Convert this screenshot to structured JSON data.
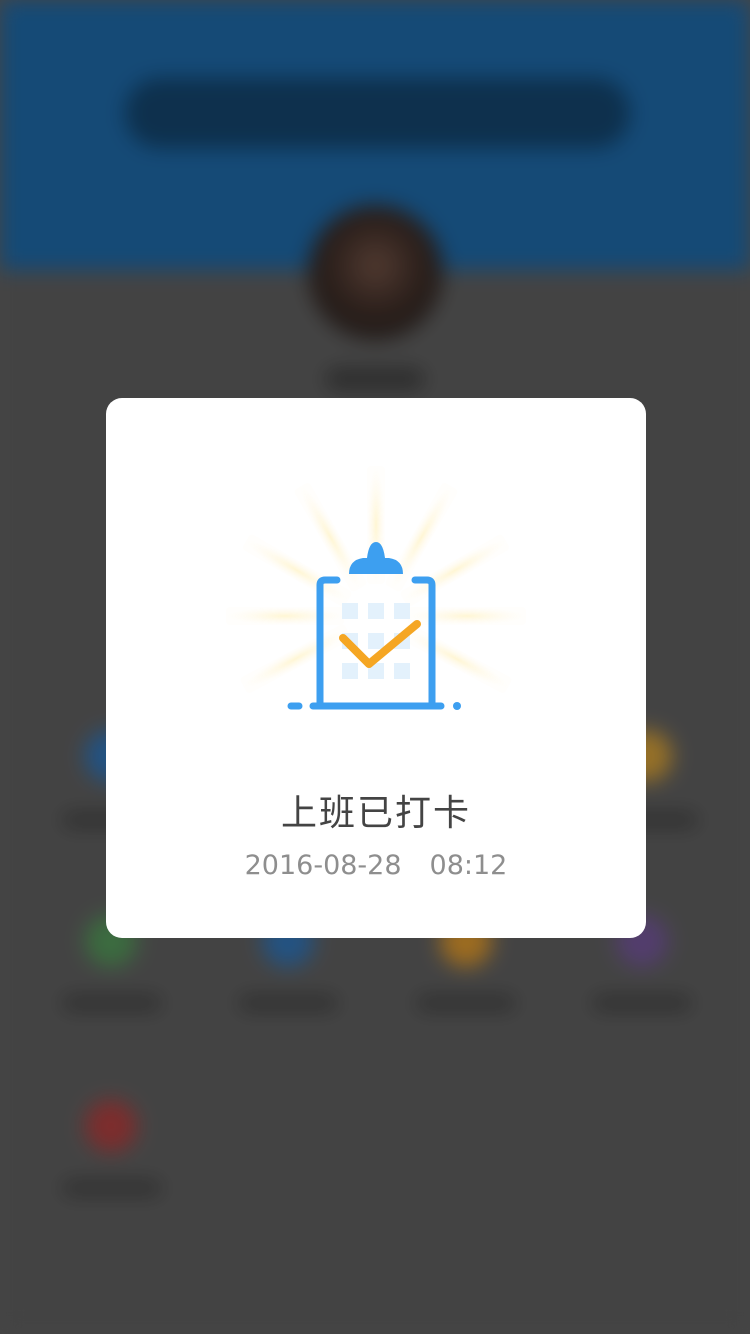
{
  "dialog": {
    "title": "上班已打卡",
    "date": "2016-08-28",
    "time": "08:12",
    "icon": "clipboard-check-icon"
  },
  "colors": {
    "header_blue": "#1b5f98",
    "dialog_bg": "#ffffff",
    "icon_blue": "#3d9ff0",
    "check_orange": "#f5a623",
    "title_text": "#444444",
    "time_text": "#8e8e8e"
  }
}
